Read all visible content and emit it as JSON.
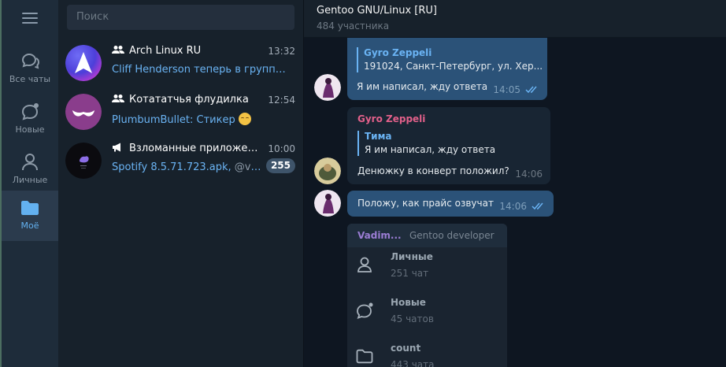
{
  "rail": {
    "folders": [
      {
        "label": "Все чаты",
        "icon": "chats-icon"
      },
      {
        "label": "Новые",
        "icon": "new-chat-icon"
      },
      {
        "label": "Личные",
        "icon": "person-icon"
      },
      {
        "label": "Моё",
        "icon": "folder-icon"
      }
    ],
    "active_index": 3
  },
  "search": {
    "placeholder": "Поиск"
  },
  "chats": [
    {
      "name": "Arch Linux RU",
      "time": "13:32",
      "preview": "Cliff Henderson теперь в группе · 1...",
      "is_group": true
    },
    {
      "name": "Котататчья флудилка",
      "time": "12:54",
      "preview": "PlumbumBullet: Стикер",
      "emoji": "relieved-face-emoji",
      "is_group": true
    },
    {
      "name": "Взломанные приложен...",
      "time": "10:00",
      "preview": "Spotify 8.5.71.723.apk,",
      "preview_author": "@vz2018",
      "unread": "255",
      "is_channel": true
    }
  ],
  "header": {
    "title": "Gentoo GNU/Linux [RU]",
    "subtitle": "484 участника"
  },
  "messages": [
    {
      "direction": "out",
      "reply_name": "Gyro Zeppeli",
      "reply_text": "191024, Санкт-Петербург, ул. Хер...",
      "text": "Я им написал, жду ответа",
      "time": "14:05",
      "read": true
    },
    {
      "direction": "in",
      "author": "Gyro Zeppeli",
      "reply_name": "Тима",
      "reply_text": "Я им написал, жду ответа",
      "text": "Денюжку в конверт положил?",
      "time": "14:06"
    },
    {
      "direction": "out",
      "text": "Положу, как прайс озвучат",
      "time": "14:06",
      "read": true
    }
  ],
  "popup": {
    "author": "Vadim...",
    "role": "Gentoo developer",
    "folders": [
      {
        "name": "Личные",
        "count": "251 чат",
        "icon": "person-icon"
      },
      {
        "name": "Новые",
        "count": "45 чатов",
        "icon": "new-chat-icon"
      },
      {
        "name": "count",
        "count": "443 чата",
        "icon": "folder-icon"
      }
    ]
  },
  "colors": {
    "accent": "#6ab3f3",
    "outgoing_bubble": "#2b5278",
    "incoming_bubble": "#182533",
    "author_pink": "#e2608a",
    "author_purple": "#9b7dd4"
  }
}
